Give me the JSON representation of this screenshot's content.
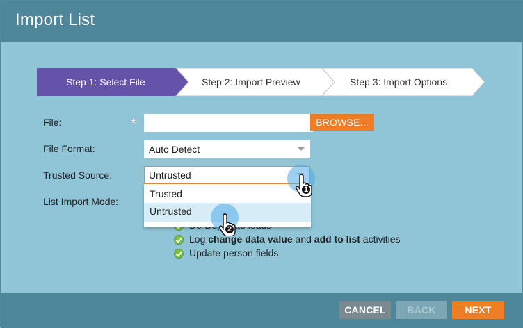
{
  "dialog": {
    "title": "Import List"
  },
  "steps": [
    {
      "label": "Step 1: Select File",
      "active": true
    },
    {
      "label": "Step 2: Import Preview",
      "active": false
    },
    {
      "label": "Step 3: Import Options",
      "active": false
    }
  ],
  "form": {
    "file_label": "File:",
    "required_mark": "*",
    "file_value": "",
    "browse_label": "BROWSE...",
    "format_label": "File Format:",
    "format_value": "Auto Detect",
    "trusted_label": "Trusted Source:",
    "trusted_value": "Untrusted",
    "trusted_options": [
      "Trusted",
      "Untrusted"
    ],
    "mode_label": "List Import Mode:"
  },
  "import_mode_items": [
    {
      "text_parts": [
        "De-Duplicate leads"
      ]
    },
    {
      "text_parts": [
        "Log ",
        "change data value",
        " and ",
        "add to list",
        " activities"
      ]
    },
    {
      "text_parts": [
        "Update person fields"
      ]
    }
  ],
  "annotations": {
    "step1": "1",
    "step2": "2"
  },
  "footer": {
    "cancel_label": "CANCEL",
    "back_label": "BACK",
    "next_label": "NEXT"
  },
  "colors": {
    "header": "#4d8799",
    "body": "#8fc5d6",
    "active_step": "#6553a9",
    "accent_orange": "#ee7d25",
    "check_green": "#7bc043"
  },
  "icons": [
    "dropdown-caret-icon",
    "check-circle-icon",
    "hand-pointer-icon"
  ]
}
